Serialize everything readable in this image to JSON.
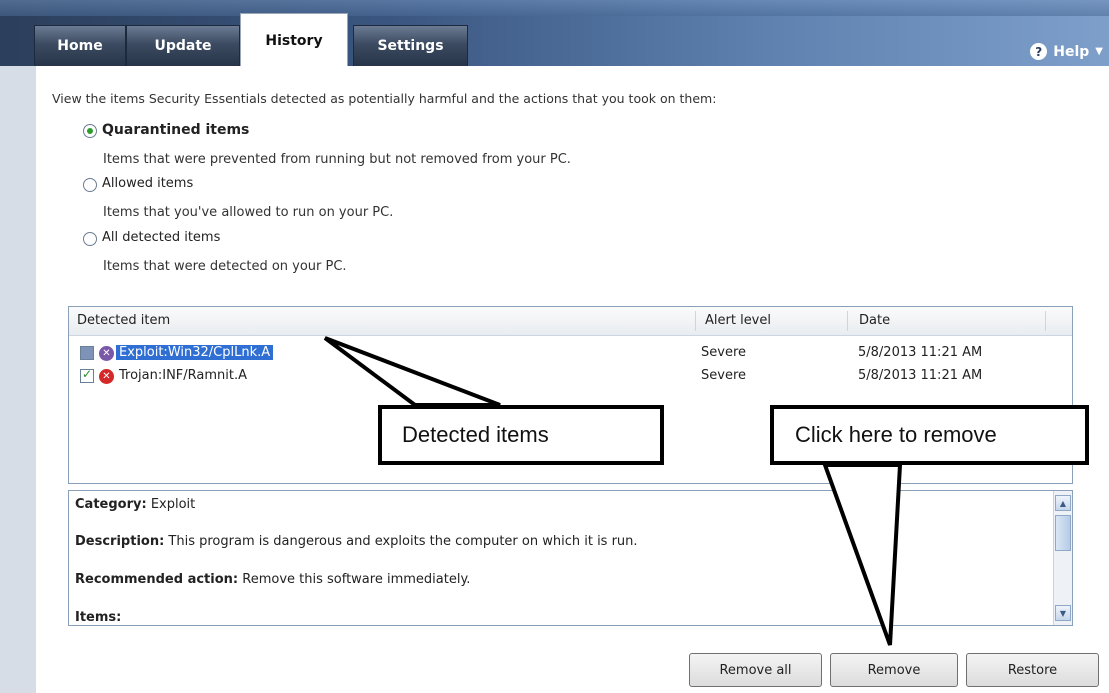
{
  "tabs": [
    {
      "label": "Home"
    },
    {
      "label": "Update"
    },
    {
      "label": "History"
    },
    {
      "label": "Settings"
    }
  ],
  "help": {
    "label": "Help",
    "icon": "question-circle-icon"
  },
  "intro_text": "View the items Security Essentials detected as potentially harmful and the actions that you took on them:",
  "filters": [
    {
      "label": "Quarantined items",
      "description": "Items that were prevented from running but not removed from your PC.",
      "selected": true
    },
    {
      "label": "Allowed items",
      "description": "Items that you've allowed to run on your PC.",
      "selected": false
    },
    {
      "label": "All detected items",
      "description": "Items that were detected on your PC.",
      "selected": false
    }
  ],
  "list": {
    "columns": [
      "Detected item",
      "Alert level",
      "Date"
    ],
    "rows": [
      {
        "checked": false,
        "selected": true,
        "icon": "threat-icon",
        "icon_color": "#7a58a8",
        "name": "Exploit:Win32/CplLnk.A",
        "alert": "Severe",
        "date": "5/8/2013 11:21 AM"
      },
      {
        "checked": true,
        "selected": false,
        "icon": "threat-icon",
        "icon_color": "#d52828",
        "name": "Trojan:INF/Ramnit.A",
        "alert": "Severe",
        "date": "5/8/2013 11:21 AM"
      }
    ]
  },
  "details": {
    "category_label": "Category:",
    "category_value": "Exploit",
    "description_label": "Description:",
    "description_value": "This program is dangerous and exploits the computer on which it is run.",
    "recommended_label": "Recommended action:",
    "recommended_value": "Remove this software immediately.",
    "items_label": "Items:"
  },
  "buttons": {
    "remove_all": "Remove all",
    "remove": "Remove",
    "restore": "Restore"
  },
  "annotations": {
    "detected": "Detected items",
    "remove_hint": "Click here to remove"
  },
  "colors": {
    "header_dark": "#2c3f5c",
    "header_light": "#7e9fca",
    "selection": "#2f6fd3"
  }
}
